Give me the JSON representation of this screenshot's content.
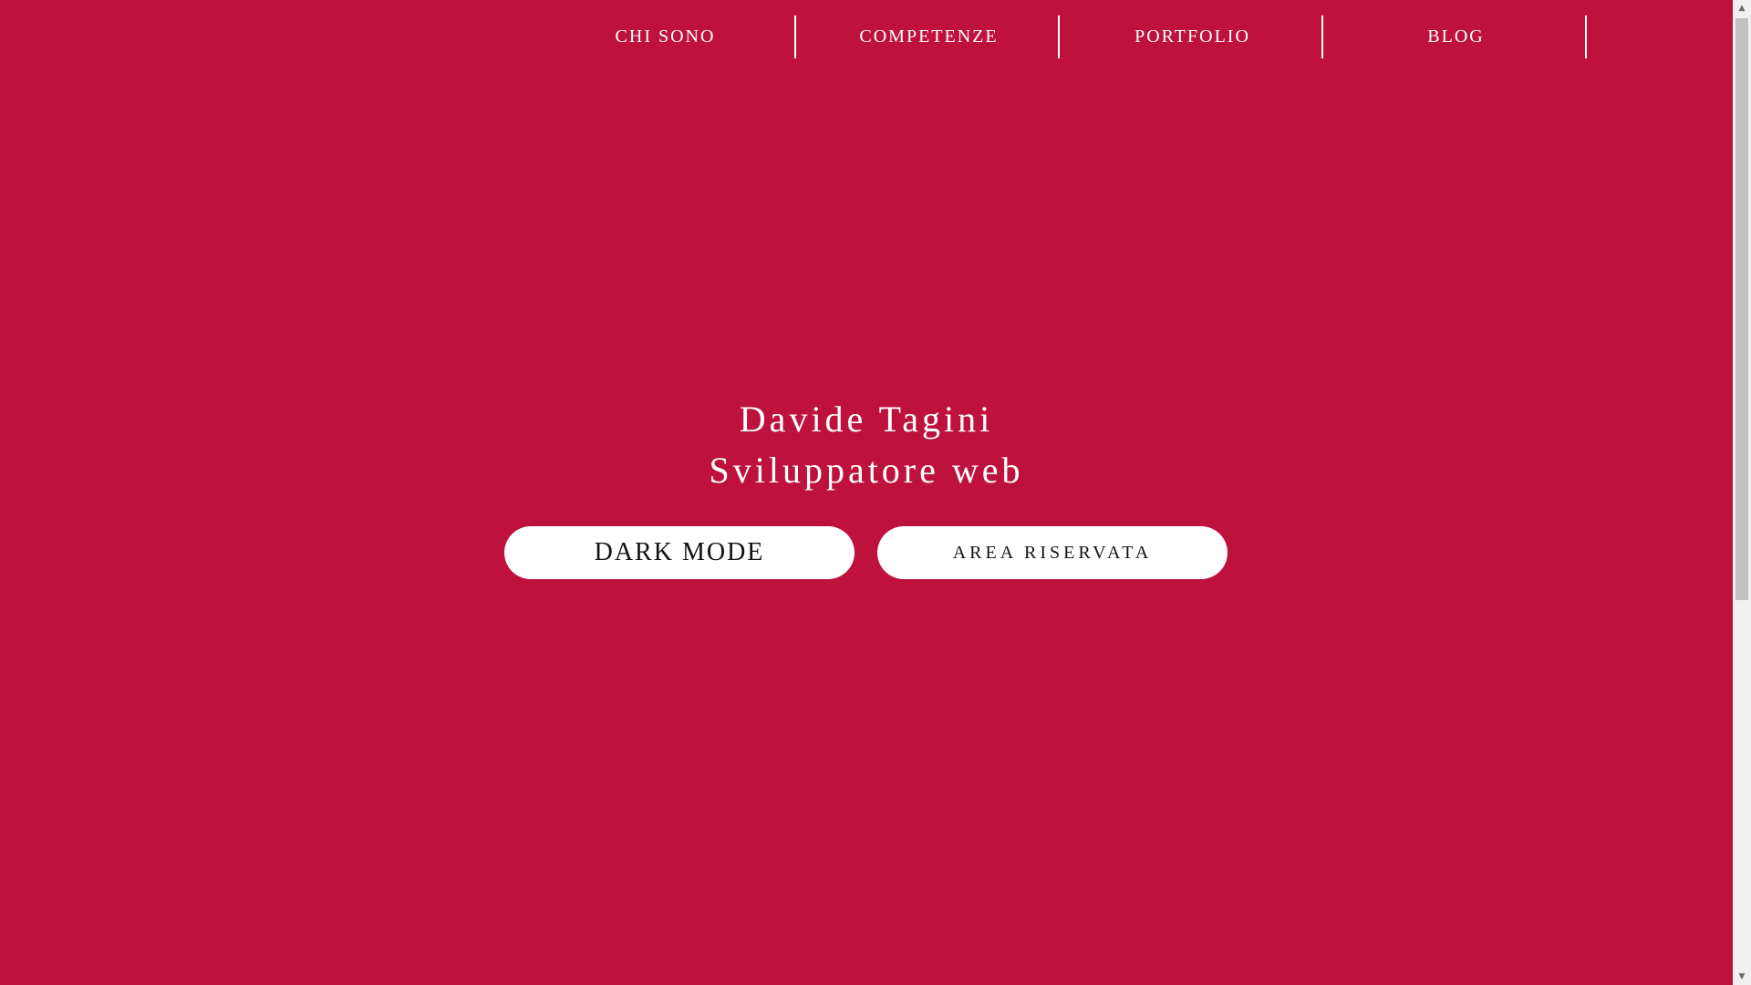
{
  "nav": {
    "items": [
      {
        "label": "CHI SONO"
      },
      {
        "label": "COMPETENZE"
      },
      {
        "label": "PORTFOLIO"
      },
      {
        "label": "BLOG"
      }
    ]
  },
  "hero": {
    "name": "Davide Tagini",
    "role": "Sviluppatore web"
  },
  "buttons": {
    "dark_mode": "DARK MODE",
    "area_riservata": "AREA RISERVATA"
  },
  "scrollbar": {
    "up_icon": "▲",
    "down_icon": "▼"
  },
  "colors": {
    "background": "#be123c",
    "text": "#ffffff",
    "button_bg": "#ffffff",
    "button_text": "#111111"
  }
}
